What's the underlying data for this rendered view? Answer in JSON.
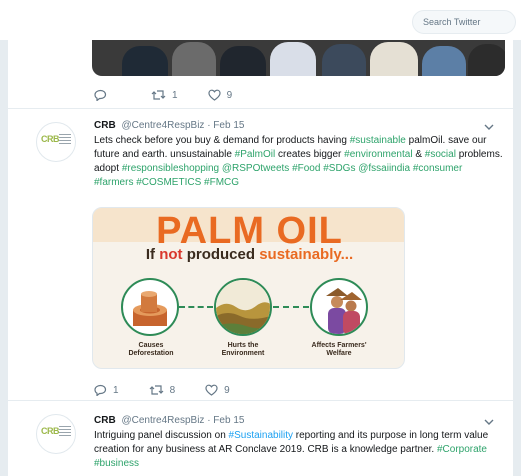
{
  "search": {
    "placeholder": "Search Twitter"
  },
  "tweet0": {
    "replies": "",
    "retweets": "1",
    "likes": "9"
  },
  "tweet1": {
    "name": "CRB",
    "handle": "@Centre4RespBiz",
    "date": "· Feb 15",
    "avatar_text": "CRB",
    "text_segments": [
      {
        "t": "Lets check before you buy & demand for products having ",
        "c": ""
      },
      {
        "t": "#sustainable",
        "c": "hg"
      },
      {
        "t": " palmOil. save our future and earth. unsustainable ",
        "c": ""
      },
      {
        "t": "#PalmOil",
        "c": "hg"
      },
      {
        "t": " creates bigger ",
        "c": ""
      },
      {
        "t": "#environmental",
        "c": "hg"
      },
      {
        "t": " & ",
        "c": ""
      },
      {
        "t": "#social",
        "c": "hg"
      },
      {
        "t": " problems. adopt ",
        "c": ""
      },
      {
        "t": "#responsibleshopping",
        "c": "hg"
      },
      {
        "t": " ",
        "c": ""
      },
      {
        "t": "@RSPOtweets",
        "c": "hg"
      },
      {
        "t": " ",
        "c": ""
      },
      {
        "t": "#Food",
        "c": "hg"
      },
      {
        "t": " ",
        "c": ""
      },
      {
        "t": "#SDGs",
        "c": "hg"
      },
      {
        "t": " ",
        "c": ""
      },
      {
        "t": "@fssaiindia",
        "c": "hg"
      },
      {
        "t": " ",
        "c": ""
      },
      {
        "t": "#consumer",
        "c": "hg"
      },
      {
        "t": " ",
        "c": ""
      },
      {
        "t": "#farmers",
        "c": "hg"
      },
      {
        "t": " ",
        "c": ""
      },
      {
        "t": "#COSMETICS",
        "c": "hg"
      },
      {
        "t": " ",
        "c": ""
      },
      {
        "t": "#FMCG",
        "c": "hg"
      }
    ],
    "card": {
      "title": "PALM OIL",
      "sub_prefix": "If ",
      "sub_not": "not",
      "sub_mid": " produced ",
      "sub_end": "sustainably...",
      "captions": [
        "Causes\nDeforestation",
        "Hurts the\nEnvironment",
        "Affects Farmers'\nWelfare"
      ]
    },
    "replies": "1",
    "retweets": "8",
    "likes": "9"
  },
  "tweet2": {
    "name": "CRB",
    "handle": "@Centre4RespBiz",
    "date": "· Feb 15",
    "avatar_text": "CRB",
    "text_segments": [
      {
        "t": "Intriguing panel discussion on ",
        "c": ""
      },
      {
        "t": "#Sustainability",
        "c": "hl"
      },
      {
        "t": " reporting and its purpose in long term value creation for any business at AR Conclave 2019. CRB is a knowledge partner. ",
        "c": ""
      },
      {
        "t": "#Corporate",
        "c": "hg"
      },
      {
        "t": " ",
        "c": ""
      },
      {
        "t": "#business",
        "c": "hg"
      }
    ]
  }
}
